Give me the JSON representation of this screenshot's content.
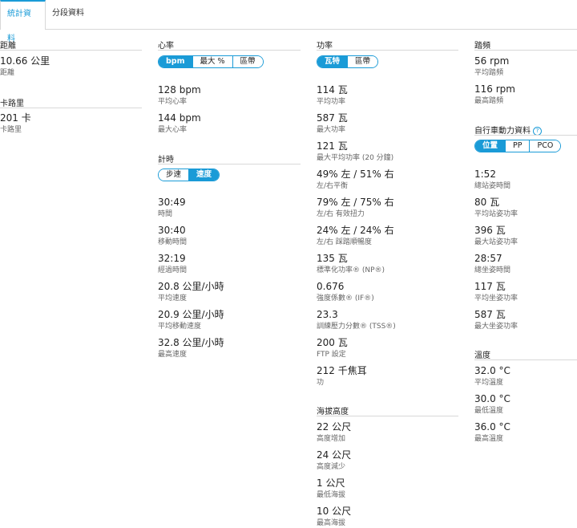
{
  "tabs": {
    "stats": "統計資料",
    "splits": "分段資料"
  },
  "distance": {
    "title": "距離",
    "items": [
      {
        "value": "10.66 公里",
        "label": "距離"
      }
    ]
  },
  "calories": {
    "title": "卡路里",
    "items": [
      {
        "value": "201 卡",
        "label": "卡路里"
      }
    ]
  },
  "heart_rate": {
    "title": "心率",
    "toggle": [
      "bpm",
      "最大 %",
      "區帶"
    ],
    "items": [
      {
        "value": "128 bpm",
        "label": "平均心率"
      },
      {
        "value": "144 bpm",
        "label": "最大心率"
      }
    ]
  },
  "timing": {
    "title": "計時",
    "toggle": [
      "步速",
      "速度"
    ],
    "items": [
      {
        "value": "30:49",
        "label": "時間"
      },
      {
        "value": "30:40",
        "label": "移動時間"
      },
      {
        "value": "32:19",
        "label": "經過時間"
      },
      {
        "value": "20.8 公里/小時",
        "label": "平均速度"
      },
      {
        "value": "20.9 公里/小時",
        "label": "平均移動速度"
      },
      {
        "value": "32.8 公里/小時",
        "label": "最高速度"
      }
    ]
  },
  "power": {
    "title": "功率",
    "toggle": [
      "瓦特",
      "區帶"
    ],
    "items": [
      {
        "value": "114 瓦",
        "label": "平均功率"
      },
      {
        "value": "587 瓦",
        "label": "最大功率"
      },
      {
        "value": "121 瓦",
        "label": "最大平均功率 (20 分鐘)"
      },
      {
        "value": "49% 左 / 51% 右",
        "label": "左/右平衡"
      },
      {
        "value": "79% 左 / 75% 右",
        "label": "左/右 有效扭力"
      },
      {
        "value": "24% 左 / 24% 右",
        "label": "左/右 踩踏順暢度"
      },
      {
        "value": "135 瓦",
        "label": "標準化功率® (NP®)"
      },
      {
        "value": "0.676",
        "label": "強度係數® (IF®)"
      },
      {
        "value": "23.3",
        "label": "訓練壓力分數® (TSS®)"
      },
      {
        "value": "200 瓦",
        "label": "FTP 設定"
      },
      {
        "value": "212 千焦耳",
        "label": "功"
      }
    ]
  },
  "elevation": {
    "title": "海拔高度",
    "items": [
      {
        "value": "22 公尺",
        "label": "高度增加"
      },
      {
        "value": "24 公尺",
        "label": "高度減少"
      },
      {
        "value": "1 公尺",
        "label": "最低海拔"
      },
      {
        "value": "10 公尺",
        "label": "最高海拔"
      }
    ]
  },
  "cadence": {
    "title": "踏頻",
    "items": [
      {
        "value": "56 rpm",
        "label": "平均踏頻"
      },
      {
        "value": "116 rpm",
        "label": "最高踏頻"
      }
    ]
  },
  "cycling_dynamics": {
    "title": "自行車動力資料",
    "toggle": [
      "位置",
      "PP",
      "PCO"
    ],
    "items": [
      {
        "value": "1:52",
        "label": "總站姿時間"
      },
      {
        "value": "80 瓦",
        "label": "平均站姿功率"
      },
      {
        "value": "396 瓦",
        "label": "最大站姿功率"
      },
      {
        "value": "28:57",
        "label": "總坐姿時間"
      },
      {
        "value": "117 瓦",
        "label": "平均坐姿功率"
      },
      {
        "value": "587 瓦",
        "label": "最大坐姿功率"
      }
    ]
  },
  "temperature": {
    "title": "溫度",
    "items": [
      {
        "value": "32.0 °C",
        "label": "平均溫度"
      },
      {
        "value": "30.0 °C",
        "label": "最低溫度"
      },
      {
        "value": "36.0 °C",
        "label": "最高溫度"
      }
    ]
  }
}
